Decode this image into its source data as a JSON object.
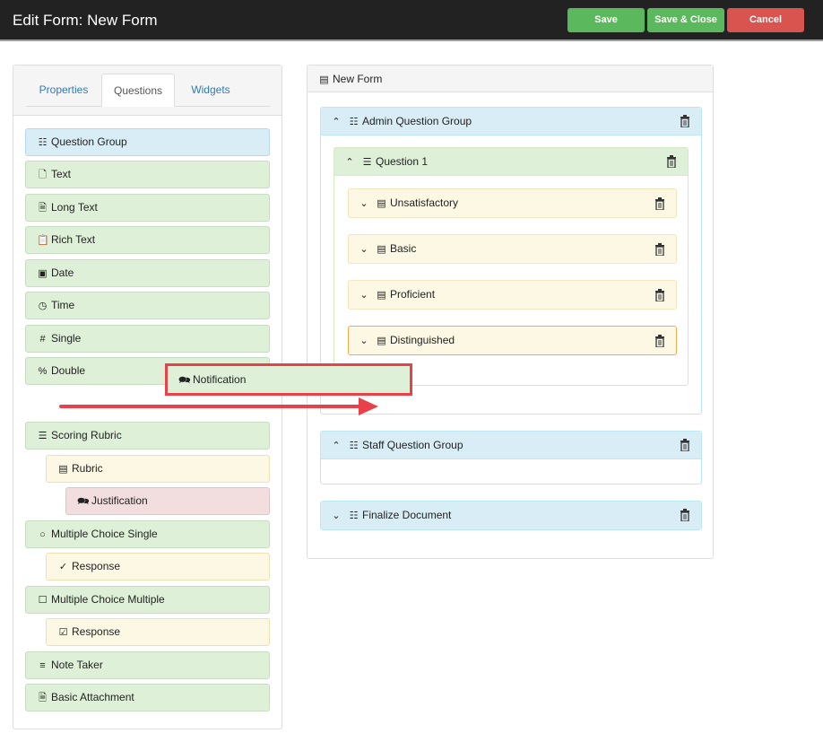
{
  "header": {
    "title": "Edit Form: New Form",
    "save_label": "Save",
    "save_close_label": "Save & Close",
    "cancel_label": "Cancel"
  },
  "tabs": [
    {
      "label": "Properties"
    },
    {
      "label": "Questions",
      "active": true
    },
    {
      "label": "Widgets"
    }
  ],
  "palette": [
    {
      "label": "Question Group",
      "icon": "list-icon"
    },
    {
      "label": "Text",
      "icon": "file-icon"
    },
    {
      "label": "Long Text",
      "icon": "file-text-icon"
    },
    {
      "label": "Rich Text",
      "icon": "clipboard-icon"
    },
    {
      "label": "Date",
      "icon": "calendar-icon"
    },
    {
      "label": "Time",
      "icon": "clock-icon"
    },
    {
      "label": "Single",
      "icon": "hash-icon"
    },
    {
      "label": "Double",
      "icon": "percent-icon"
    },
    {
      "label": "Scoring Rubric",
      "icon": "checklist-icon"
    },
    {
      "label": "Rubric",
      "icon": "rubric-icon"
    },
    {
      "label": "Justification",
      "icon": "chat-icon"
    },
    {
      "label": "Multiple Choice Single",
      "icon": "radio-icon"
    },
    {
      "label": "Response",
      "icon": "check-circle-icon"
    },
    {
      "label": "Multiple Choice Multiple",
      "icon": "checkbox-icon"
    },
    {
      "label": "Response",
      "icon": "check-square-icon"
    },
    {
      "label": "Note Taker",
      "icon": "menu-icon"
    },
    {
      "label": "Basic Attachment",
      "icon": "attachment-icon"
    }
  ],
  "dragging": {
    "label": "Notification",
    "icon": "chat-icon"
  },
  "form": {
    "title": "New Form",
    "groups": [
      {
        "title": "Admin Question Group",
        "question": {
          "title": "Question 1",
          "options": [
            "Unsatisfactory",
            "Basic",
            "Proficient",
            "Distinguished"
          ]
        }
      },
      {
        "title": "Staff Question Group"
      },
      {
        "title": "Finalize Document"
      }
    ]
  },
  "colors": {
    "green": "#5cb85c",
    "red": "#d9534f",
    "highlight": "#e8414a"
  }
}
